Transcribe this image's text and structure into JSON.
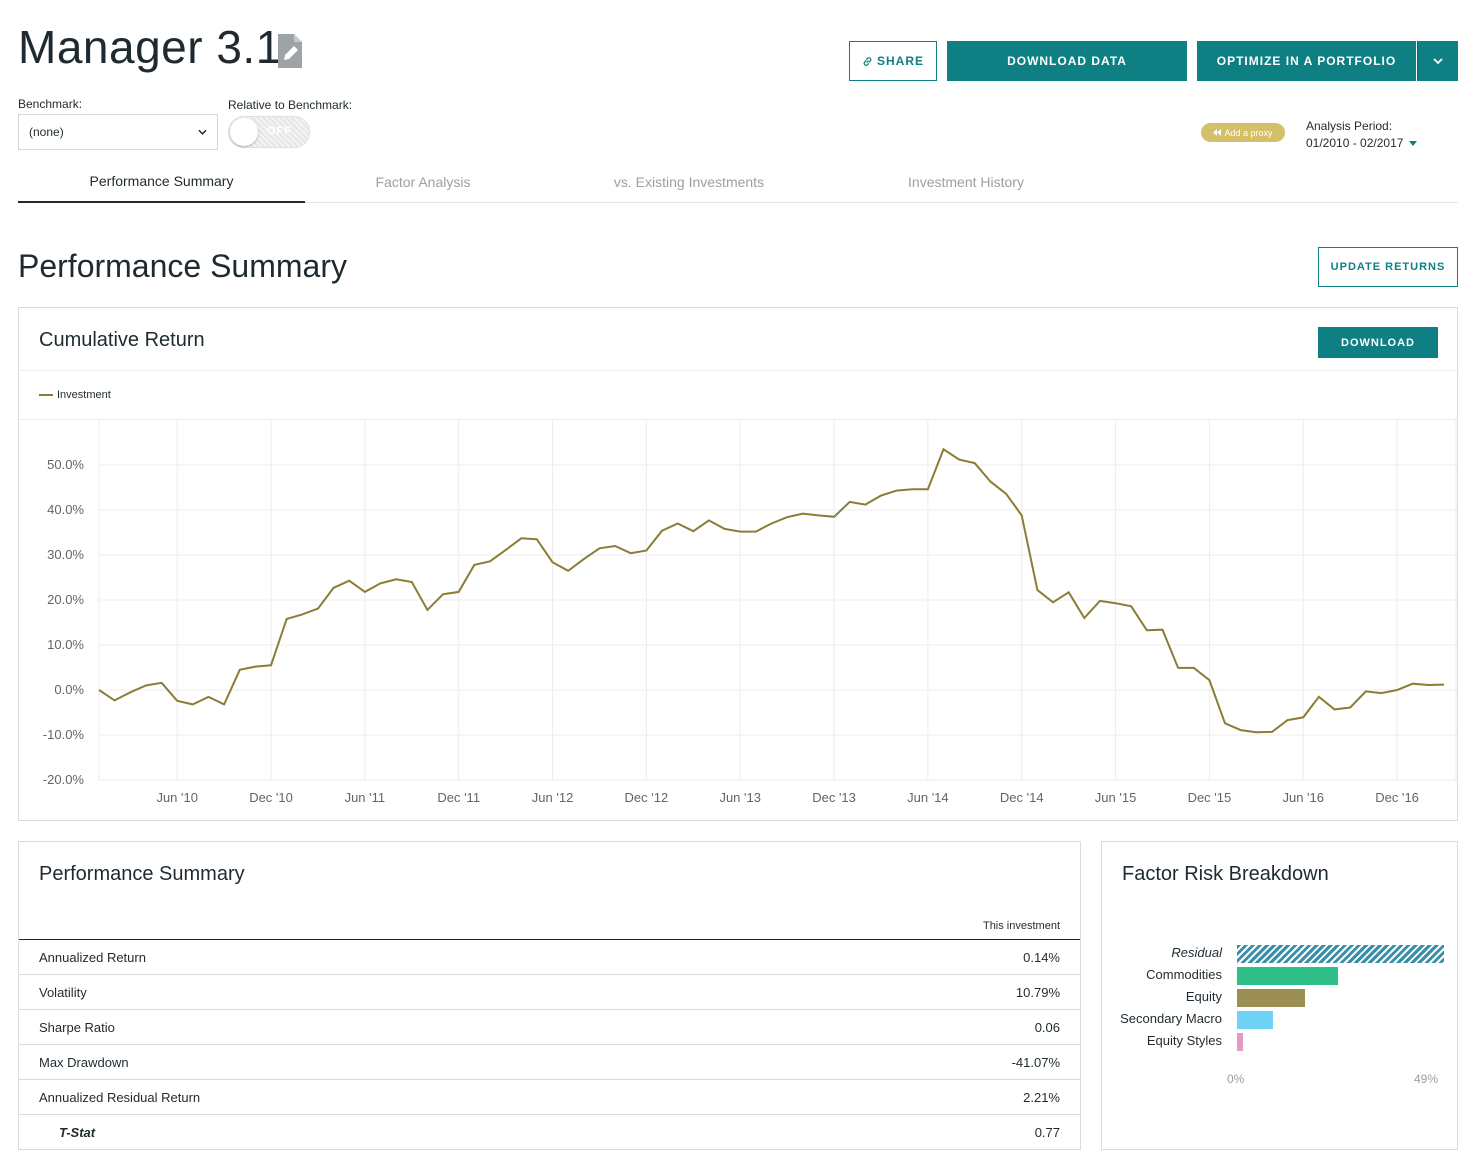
{
  "header": {
    "title": "Manager 3.1",
    "share_label": "SHARE",
    "download_data_label": "DOWNLOAD DATA",
    "optimize_label": "OPTIMIZE IN A PORTFOLIO",
    "benchmark_label": "Benchmark:",
    "benchmark_value": "(none)",
    "relative_label": "Relative to Benchmark:",
    "toggle_text": "OFF",
    "proxy_label": "Add a proxy",
    "period_label": "Analysis Period:",
    "period_value": "01/2010 - 02/2017"
  },
  "tabs": [
    {
      "label": "Performance Summary",
      "active": true
    },
    {
      "label": "Factor Analysis",
      "active": false
    },
    {
      "label": "vs. Existing Investments",
      "active": false
    },
    {
      "label": "Investment History",
      "active": false
    }
  ],
  "section": {
    "title": "Performance Summary",
    "update_label": "UPDATE RETURNS"
  },
  "chart_panel": {
    "title": "Cumulative Return",
    "download_label": "DOWNLOAD",
    "legend_label": "Investment"
  },
  "chart_data": {
    "type": "line",
    "title": "Cumulative Return",
    "ylim": [
      -20,
      60
    ],
    "yticks": [
      -20,
      -10,
      0,
      10,
      20,
      30,
      40,
      50
    ],
    "ytick_labels": [
      "-20.0%",
      "-10.0%",
      "0.0%",
      "10.0%",
      "20.0%",
      "30.0%",
      "40.0%",
      "50.0%"
    ],
    "xtick_labels": [
      "Jun '10",
      "Dec '10",
      "Jun '11",
      "Dec '11",
      "Jun '12",
      "Dec '12",
      "Jun '13",
      "Dec '13",
      "Jun '14",
      "Dec '14",
      "Jun '15",
      "Dec '15",
      "Jun '16",
      "Dec '16"
    ],
    "xtick_months": [
      5,
      11,
      17,
      23,
      29,
      35,
      41,
      47,
      53,
      59,
      65,
      71,
      77,
      83
    ],
    "x_start": "01/2010",
    "x_months": 86,
    "grid": true,
    "legend_position": "top-left",
    "series": [
      {
        "name": "Investment",
        "color": "#8a7d35",
        "values": [
          0,
          -2.3,
          -0.5,
          1,
          1.6,
          -2.4,
          -3.2,
          -1.5,
          -3.2,
          4.5,
          5.2,
          5.5,
          15.8,
          16.8,
          18.1,
          22.7,
          24.3,
          21.8,
          23.7,
          24.6,
          24,
          17.8,
          21.3,
          21.8,
          27.8,
          28.6,
          31.1,
          33.7,
          33.5,
          28.4,
          26.5,
          29.1,
          31.5,
          32,
          30.4,
          31,
          35.4,
          37,
          35.3,
          37.7,
          35.8,
          35.2,
          35.2,
          37,
          38.4,
          39.2,
          38.8,
          38.5,
          41.8,
          41.2,
          43.2,
          44.3,
          44.6,
          44.6,
          53.5,
          51.2,
          50.4,
          46.3,
          43.6,
          38.8,
          22.2,
          19.5,
          21.7,
          16,
          19.8,
          19.3,
          18.6,
          13.3,
          13.4,
          4.9,
          4.9,
          2.2,
          -7.4,
          -8.9,
          -9.4,
          -9.3,
          -6.7,
          -6.1,
          -1.5,
          -4.3,
          -3.9,
          -0.3,
          -0.7,
          0,
          1.4,
          1.1,
          1.2
        ]
      }
    ]
  },
  "perf_table": {
    "title": "Performance Summary",
    "column_header": "This investment",
    "rows": [
      {
        "label": "Annualized Return",
        "value": "0.14%",
        "italic": false
      },
      {
        "label": "Volatility",
        "value": "10.79%",
        "italic": false
      },
      {
        "label": "Sharpe Ratio",
        "value": "0.06",
        "italic": false
      },
      {
        "label": "Max Drawdown",
        "value": "-41.07%",
        "italic": false
      },
      {
        "label": "Annualized Residual Return",
        "value": "2.21%",
        "italic": false
      },
      {
        "label": "T-Stat",
        "value": "0.77",
        "italic": true
      }
    ]
  },
  "factor": {
    "title": "Factor Risk Breakdown",
    "axis_min_label": "0%",
    "axis_max_label": "49%",
    "max": 49,
    "items": [
      {
        "label": "Residual",
        "value": 49,
        "color": "#3a8fa8",
        "hatched": true
      },
      {
        "label": "Commodities",
        "value": 24,
        "color": "#2fc08a",
        "hatched": false
      },
      {
        "label": "Equity",
        "value": 16,
        "color": "#9b8f55",
        "hatched": false
      },
      {
        "label": "Secondary Macro",
        "value": 8.5,
        "color": "#6fd3f5",
        "hatched": false
      },
      {
        "label": "Equity Styles",
        "value": 1.5,
        "color": "#e39bc6",
        "hatched": false
      }
    ]
  }
}
